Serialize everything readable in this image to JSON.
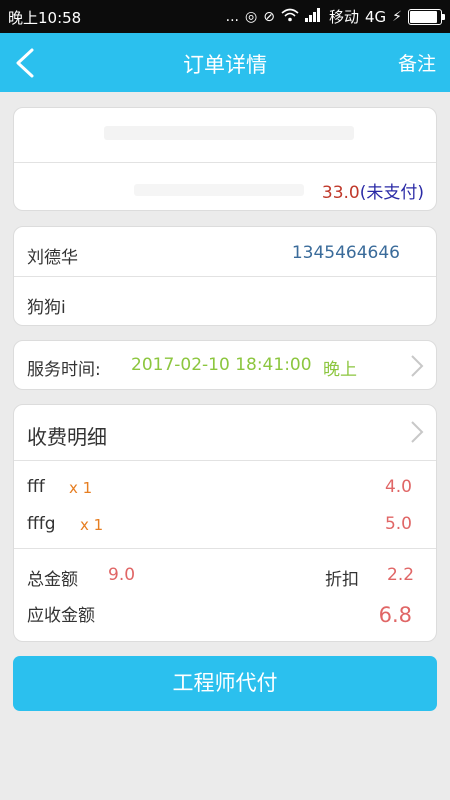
{
  "status_bar": {
    "time": "晚上10:58",
    "dots": "...",
    "carrier": "移动",
    "network": "4G",
    "battery_level": 0.9
  },
  "header": {
    "back_icon": "chevron-left-icon",
    "title": "订单详情",
    "remark_label": "备注"
  },
  "order": {
    "amount": "33.0",
    "payment_status": "(未支付)"
  },
  "customer": {
    "name": "刘德华",
    "phone": "1345464646",
    "pet": "狗狗i"
  },
  "service": {
    "label": "服务时间:",
    "time": "2017-02-10 18:41:00",
    "period": "晚上"
  },
  "fees": {
    "title": "收费明细",
    "items": [
      {
        "name": "fff",
        "qty": "x 1",
        "price": "4.0"
      },
      {
        "name": "fffg",
        "qty": "x 1",
        "price": "5.0"
      }
    ],
    "total_label": "总金额",
    "total_value": "9.0",
    "discount_label": "折扣",
    "discount_value": "2.2",
    "receivable_label": "应收金额",
    "receivable_value": "6.8"
  },
  "actions": {
    "pay_label": "工程师代付"
  },
  "colors": {
    "accent": "#2bc0ee",
    "price_red": "#e06666",
    "time_green": "#8cc63f",
    "qty_orange": "#e67e22",
    "phone_blue": "#3a6b9a"
  }
}
